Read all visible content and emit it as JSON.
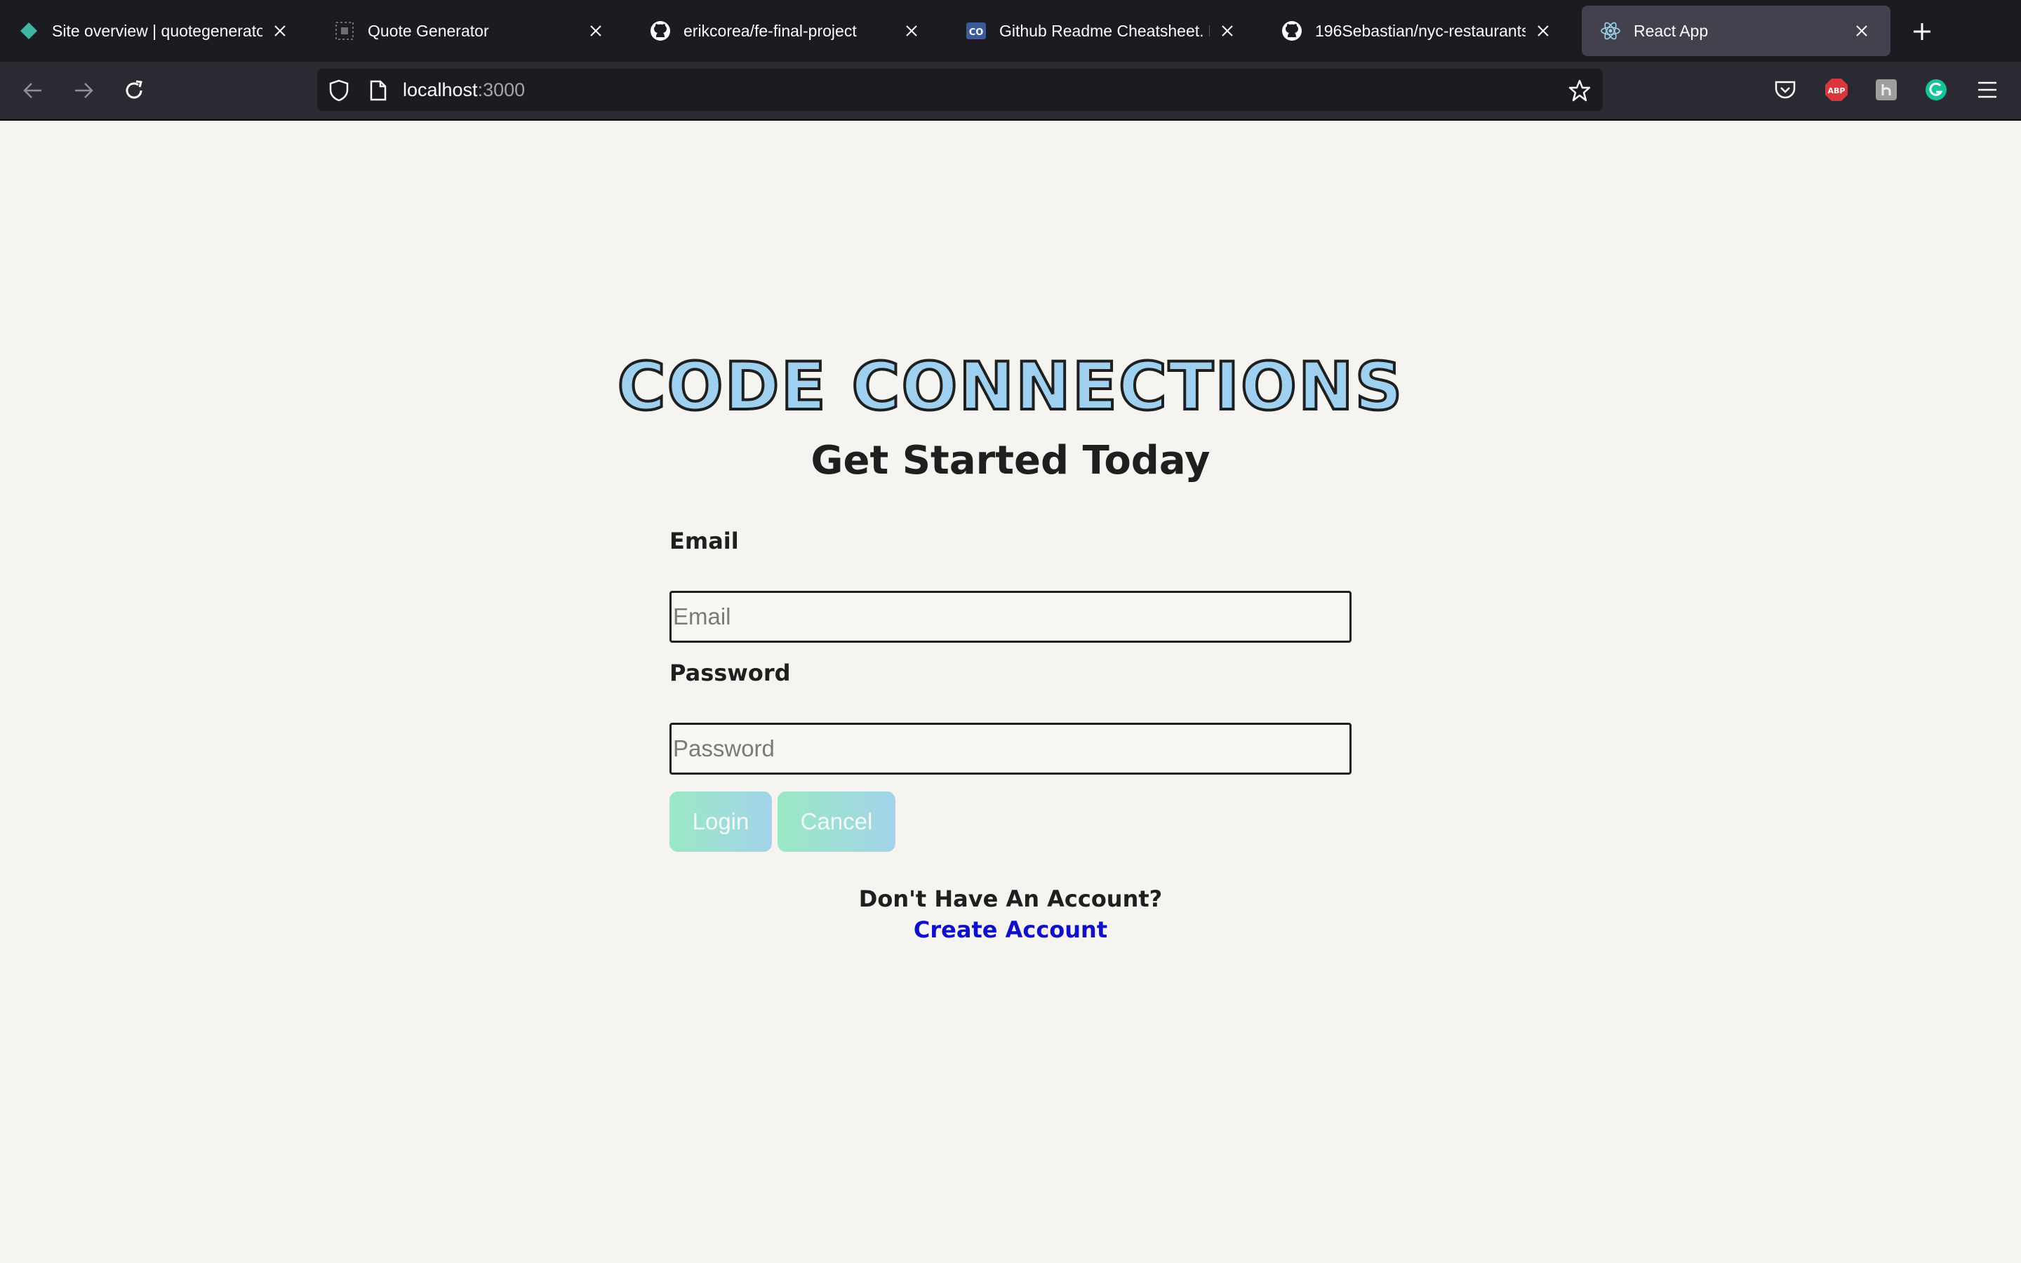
{
  "browser": {
    "tabs": [
      {
        "title": "Site overview | quotegeneratora",
        "icon": "netlify-icon"
      },
      {
        "title": "Quote Generator",
        "icon": "quote-icon"
      },
      {
        "title": "erikcorea/fe-final-project",
        "icon": "github-icon"
      },
      {
        "title": "Github Readme Cheatsheet. For",
        "icon": "codeopinion-icon"
      },
      {
        "title": "196Sebastian/nyc-restaurants",
        "icon": "github-icon"
      },
      {
        "title": "React App",
        "icon": "react-icon",
        "active": true
      }
    ],
    "url": {
      "host": "localhost",
      "port": ":3000"
    },
    "extensions": [
      "pocket-icon",
      "adblock-icon",
      "extension-icon",
      "grammarly-icon",
      "menu-icon"
    ],
    "adblock_label": "ABP",
    "colors": {
      "tabstrip": "#1c1b22",
      "navbar": "#2b2a33",
      "active_tab": "#42414d"
    }
  },
  "page": {
    "brand": "CODE CONNECTIONS",
    "subtitle": "Get Started Today",
    "email_label": "Email",
    "email_placeholder": "Email",
    "email_value": "",
    "password_label": "Password",
    "password_placeholder": "Password",
    "password_value": "",
    "login_label": "Login",
    "cancel_label": "Cancel",
    "no_account_text": "Don't Have An Account?",
    "create_account_link": "Create Account",
    "colors": {
      "background": "#f5f4f0",
      "brand_fill": "#9fd0ef",
      "link": "#1010c8",
      "button_gradient_start": "#9be8c4",
      "button_gradient_end": "#a2d4ea"
    }
  }
}
